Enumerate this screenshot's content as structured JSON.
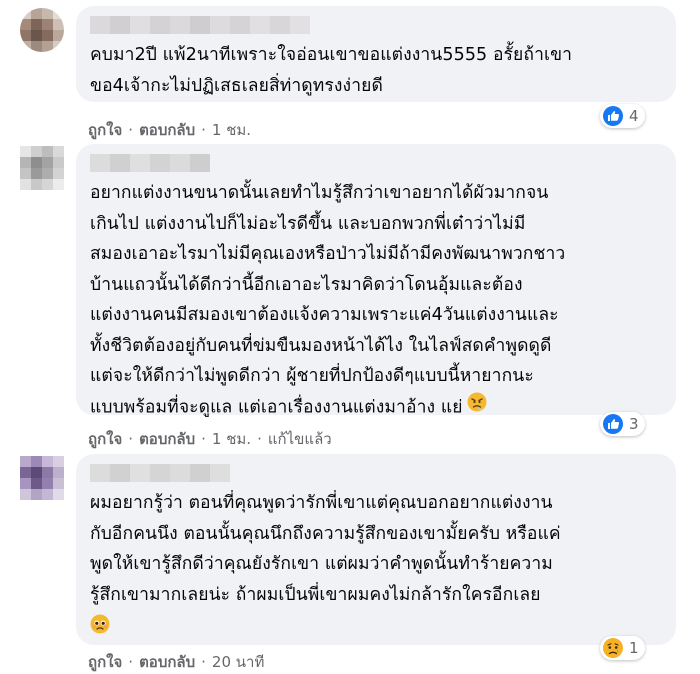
{
  "comments": [
    {
      "text": "คบมา2ปี แพ้2นาทีเพราะใจอ่อนเขาขอแต่งงาน5555 อรั้ยถ้าเขา\nขอ4เจ้ากะไม่ปฏิเสธเลยสิ่ท่าดูทรงง่ายดี",
      "like_label": "ถูกใจ",
      "reply_label": "ตอบกลับ",
      "time": "1 ชม.",
      "reaction_count": "4",
      "reaction": "like-icon"
    },
    {
      "text": "อยากแต่งงานขนาดนั้นเลยทำไมรู้สึกว่าเขาอยากได้ผัวมากจน\nเกินไป แต่งงานไปก็ไม่อะไรดีขึ้น และบอกพวกพี่เต๋าว่าไม่มี\nสมองเอาอะไรมาไม่มีคุณเองหรือป่าวไม่มีถ้ามีคงพัฒนาพวกชาว\nบ้านแถวนั้นได้ดีกว่านี้อีกเอาอะไรมาคิดว่าโดนอุ้มและต้อง\nแต่งงานคนมีสมองเขาต้องแจ้งความเพราะแค่4วันแต่งงานและ\nทั้งชีวิตต้องอยู่กับคนที่ข่มขืนมองหน้าได้ไง ในไลฟ์สดคำพูดดูดี\nแต่จะให้ดีกว่าไม่พูดดีกว่า ผู้ชายที่ปกป้องดีๆแบบนี้หายากนะ\nแบบพร้อมที่จะดูแล แต่เอาเรื่องงานแต่งมาอ้าง แย่",
      "like_label": "ถูกใจ",
      "reply_label": "ตอบกลับ",
      "time": "1 ชม.",
      "edited_label": "แก้ไขแล้ว",
      "reaction_count": "3",
      "reaction": "like-icon",
      "trailing_emoji": "angry-face-icon"
    },
    {
      "text": "ผมอยากรู้ว่า ตอนที่คุณพูดว่ารักพี่เขาแต่คุณบอกอยากแต่งงาน\nกับอีกคนนึง ตอนนั้นคุณนึกถึงความรู้สึกของเขามั้ยครับ หรือแค่\nพูดให้เขารู้สึกดีว่าคุณยังรักเขา แต่ผมว่าคำพูดนั้นทำร้ายความ\nรู้สึกเขามากเลยน่ะ ถ้าผมเป็นพี่เขาผมคงไม่กล้ารักใครอีกเลย",
      "like_label": "ถูกใจ",
      "reply_label": "ตอบกลับ",
      "time": "20 นาที",
      "reaction_count": "1",
      "reaction": "sad-icon",
      "trailing_emoji": "pleading-face-icon"
    }
  ],
  "colors": {
    "bubble": "#f0f2f5",
    "meta": "#65676b",
    "like_blue": "#1877f2",
    "sad_yellow": "#f7b125"
  }
}
